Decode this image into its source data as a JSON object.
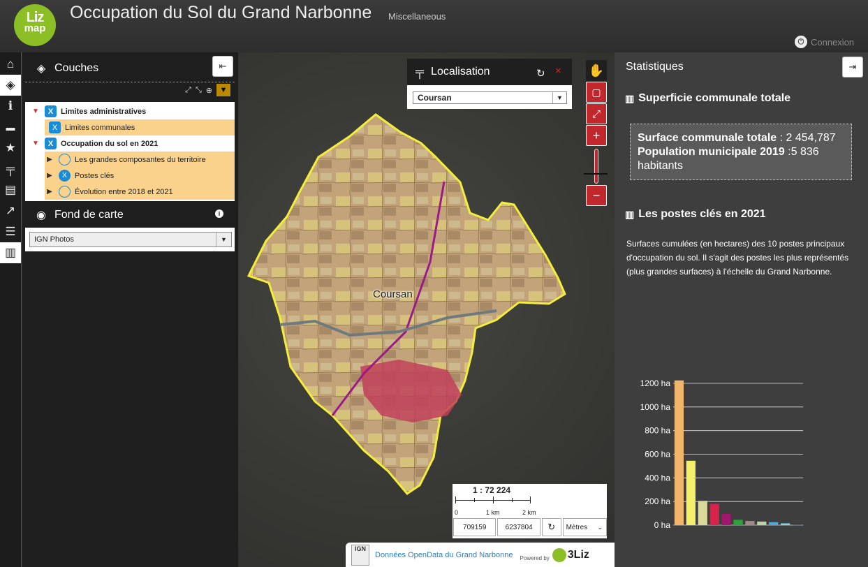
{
  "header": {
    "logo_line1": "Liz",
    "logo_line2": "map",
    "title": "Occupation du Sol du Grand Narbonne",
    "subtitle": "Miscellaneous",
    "connexion": "Connexion"
  },
  "dock": {
    "layers_title": "Couches",
    "basemap_title": "Fond de carte",
    "basemap_selected": "IGN Photos",
    "tree": [
      {
        "label": "Limites administratives",
        "type": "group",
        "checked": true
      },
      {
        "label": "Limites communales",
        "type": "layer",
        "checked": true
      },
      {
        "label": "Occupation du sol en 2021",
        "type": "group",
        "checked": true
      },
      {
        "label": "Les grandes composantes du territoire",
        "type": "radio",
        "checked": false
      },
      {
        "label": "Postes clés",
        "type": "radio",
        "checked": true
      },
      {
        "label": "Évolution entre 2018 et 2021",
        "type": "radio",
        "checked": false
      }
    ]
  },
  "localisation": {
    "title": "Localisation",
    "selected": "Coursan"
  },
  "map": {
    "commune_label": "Coursan",
    "scale_ratio": "1 : 72 224",
    "scale_labels": [
      "0",
      "1 km",
      "2 km"
    ],
    "coord_x": "709159",
    "coord_y": "6237804",
    "unit": "Mètres",
    "attribution": "Données OpenData du Grand Narbonne",
    "ign_label": "IGN",
    "powered_by": "Powered by",
    "powered_brand": "3Liz"
  },
  "stats": {
    "title": "Statistiques",
    "section1": "Superficie communale totale",
    "surface_label": "Surface communale totale",
    "surface_value": " : 2 454,787",
    "pop_label": "Population municipale 2019",
    "pop_value": " :5 836",
    "pop_unit": "habitants",
    "section2": "Les postes clés en 2021",
    "description": "Surfaces cumulées (en hectares) des 10 postes principaux d'occupation du sol. Il s'agit des postes les plus représentés (plus grandes surfaces) à l'échelle du Grand Narbonne."
  },
  "chart_data": {
    "type": "bar",
    "values": [
      1225,
      545,
      205,
      180,
      95,
      45,
      35,
      30,
      25,
      15,
      5
    ],
    "colors": [
      "#f2b56b",
      "#f5f069",
      "#d9d99a",
      "#d8244a",
      "#a0176e",
      "#2aa33d",
      "#a08a8a",
      "#b9d3a2",
      "#4fa7de",
      "#7dd6e0",
      "#3a6ab3"
    ],
    "ylim": [
      0,
      1200
    ],
    "yticks": [
      0,
      200,
      400,
      600,
      800,
      1000,
      1200
    ],
    "y_unit": "ha",
    "grid": true
  },
  "colors": {
    "accent_red": "#c0282d",
    "checkbox_blue": "#1a8bd6",
    "lizmap_green": "#8cbf26",
    "highlight": "#fbd28c"
  }
}
